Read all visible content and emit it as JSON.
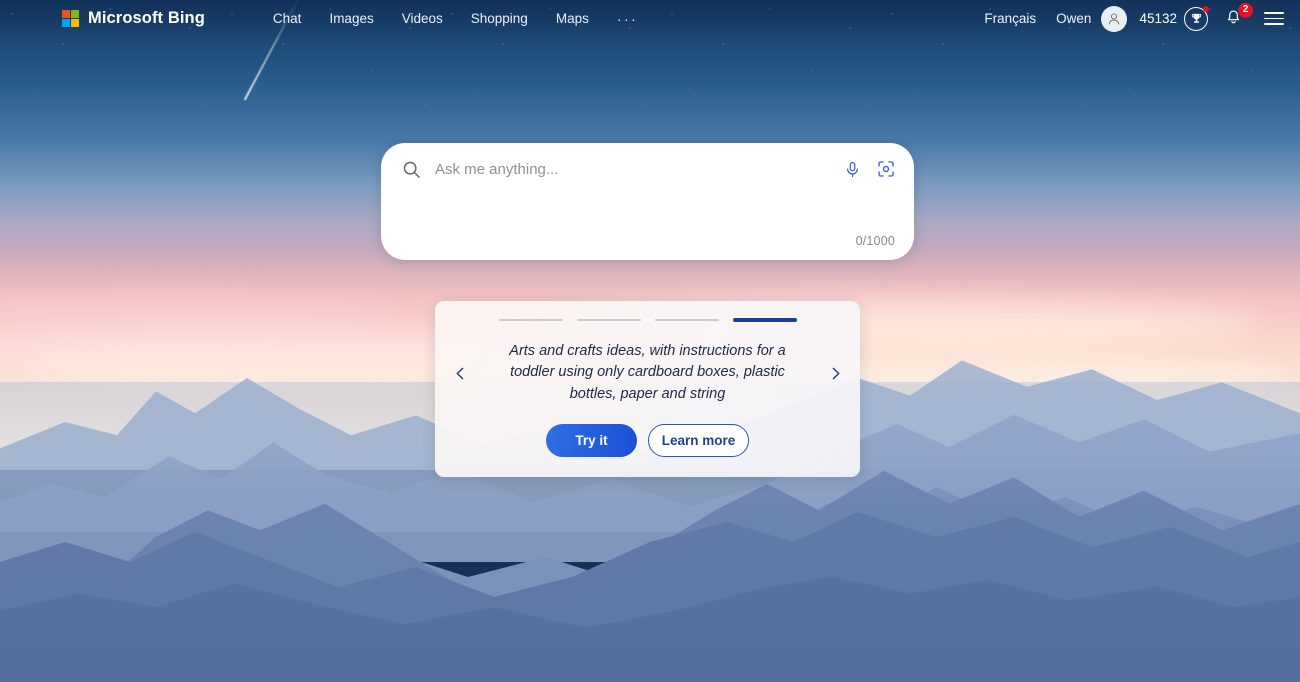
{
  "header": {
    "brand": "Microsoft Bing",
    "logo_icon": "microsoft-squares-icon",
    "nav": [
      {
        "label": "Chat"
      },
      {
        "label": "Images"
      },
      {
        "label": "Videos"
      },
      {
        "label": "Shopping"
      },
      {
        "label": "Maps"
      }
    ],
    "more_label": "···",
    "language": "Français",
    "user_name": "Owen",
    "avatar_icon": "person-avatar-icon",
    "rewards_points": "45132",
    "rewards_icon": "trophy-icon",
    "notifications_icon": "bell-icon",
    "notifications_count": "2",
    "menu_icon": "hamburger-menu-icon"
  },
  "search": {
    "placeholder": "Ask me anything...",
    "value": "",
    "search_icon": "search-icon",
    "mic_icon": "microphone-icon",
    "lens_icon": "visual-search-camera-icon",
    "counter": "0/1000"
  },
  "carousel": {
    "slides_total": 4,
    "active_slide": 4,
    "suggestion": "Arts and crafts ideas, with instructions for a toddler using only cardboard boxes, plastic bottles, paper and string",
    "prev_icon": "chevron-left-icon",
    "next_icon": "chevron-right-icon",
    "try_label": "Try it",
    "learn_label": "Learn more"
  },
  "colors": {
    "accent_blue": "#1b4fd4",
    "active_indicator": "#1b3f9e",
    "badge_red": "#e81123",
    "inactive_indicator": "#c9c9c9"
  }
}
